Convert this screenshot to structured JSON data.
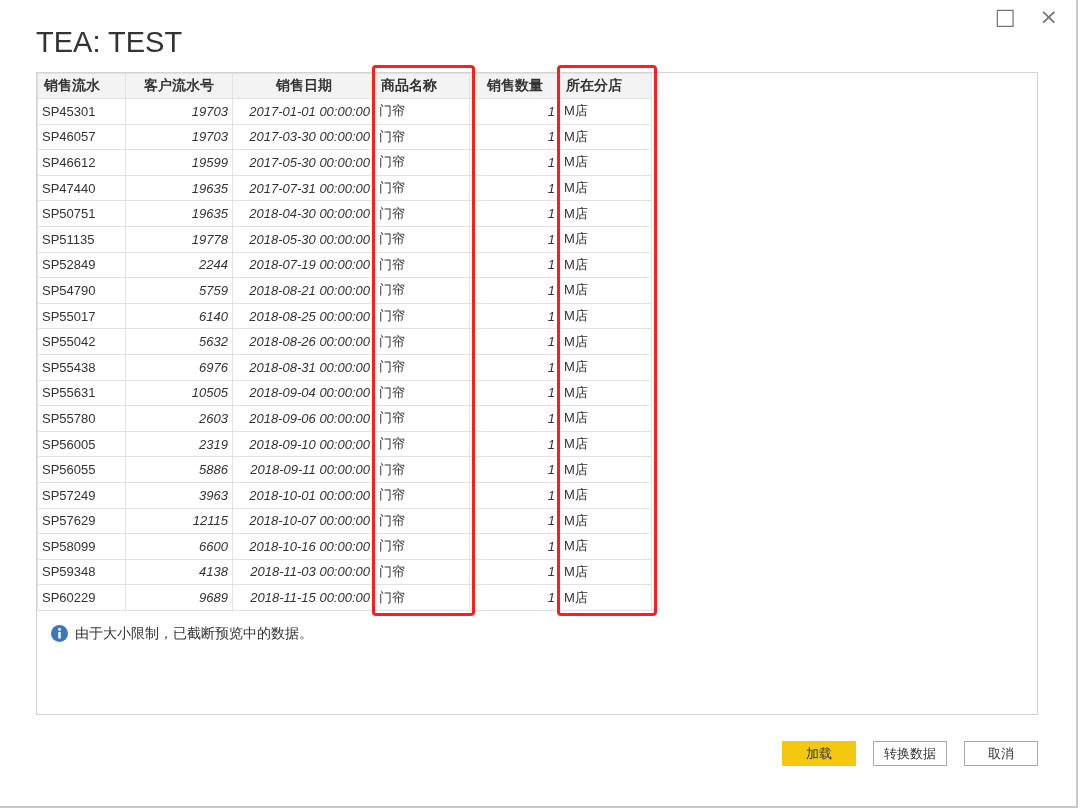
{
  "window": {
    "title": "TEA: TEST",
    "controls": [
      "□",
      "×"
    ]
  },
  "table": {
    "columns": [
      {
        "label": "销售流水",
        "kind": "text",
        "highlighted": false
      },
      {
        "label": "客户流水号",
        "kind": "number",
        "highlighted": false
      },
      {
        "label": "销售日期",
        "kind": "number",
        "highlighted": false
      },
      {
        "label": "商品名称",
        "kind": "text",
        "highlighted": true
      },
      {
        "label": "销售数量",
        "kind": "number",
        "highlighted": false
      },
      {
        "label": "所在分店",
        "kind": "text",
        "highlighted": true
      }
    ],
    "rows": [
      [
        "SP45301",
        "19703",
        "2017-01-01 00:00:00",
        "门帘",
        "1",
        "M店"
      ],
      [
        "SP46057",
        "19703",
        "2017-03-30 00:00:00",
        "门帘",
        "1",
        "M店"
      ],
      [
        "SP46612",
        "19599",
        "2017-05-30 00:00:00",
        "门帘",
        "1",
        "M店"
      ],
      [
        "SP47440",
        "19635",
        "2017-07-31 00:00:00",
        "门帘",
        "1",
        "M店"
      ],
      [
        "SP50751",
        "19635",
        "2018-04-30 00:00:00",
        "门帘",
        "1",
        "M店"
      ],
      [
        "SP51135",
        "19778",
        "2018-05-30 00:00:00",
        "门帘",
        "1",
        "M店"
      ],
      [
        "SP52849",
        "2244",
        "2018-07-19 00:00:00",
        "门帘",
        "1",
        "M店"
      ],
      [
        "SP54790",
        "5759",
        "2018-08-21 00:00:00",
        "门帘",
        "1",
        "M店"
      ],
      [
        "SP55017",
        "6140",
        "2018-08-25 00:00:00",
        "门帘",
        "1",
        "M店"
      ],
      [
        "SP55042",
        "5632",
        "2018-08-26 00:00:00",
        "门帘",
        "1",
        "M店"
      ],
      [
        "SP55438",
        "6976",
        "2018-08-31 00:00:00",
        "门帘",
        "1",
        "M店"
      ],
      [
        "SP55631",
        "10505",
        "2018-09-04 00:00:00",
        "门帘",
        "1",
        "M店"
      ],
      [
        "SP55780",
        "2603",
        "2018-09-06 00:00:00",
        "门帘",
        "1",
        "M店"
      ],
      [
        "SP56005",
        "2319",
        "2018-09-10 00:00:00",
        "门帘",
        "1",
        "M店"
      ],
      [
        "SP56055",
        "5886",
        "2018-09-11 00:00:00",
        "门帘",
        "1",
        "M店"
      ],
      [
        "SP57249",
        "3963",
        "2018-10-01 00:00:00",
        "门帘",
        "1",
        "M店"
      ],
      [
        "SP57629",
        "12115",
        "2018-10-07 00:00:00",
        "门帘",
        "1",
        "M店"
      ],
      [
        "SP58099",
        "6600",
        "2018-10-16 00:00:00",
        "门帘",
        "1",
        "M店"
      ],
      [
        "SP59348",
        "4138",
        "2018-11-03 00:00:00",
        "门帘",
        "1",
        "M店"
      ],
      [
        "SP60229",
        "9689",
        "2018-11-15 00:00:00",
        "门帘",
        "1",
        "M店"
      ]
    ]
  },
  "notice": "由于大小限制，已截断预览中的数据。",
  "buttons": [
    {
      "label": "加载",
      "kind": "primary"
    },
    {
      "label": "转换数据",
      "kind": "secondary"
    },
    {
      "label": "取消",
      "kind": "secondary"
    }
  ]
}
